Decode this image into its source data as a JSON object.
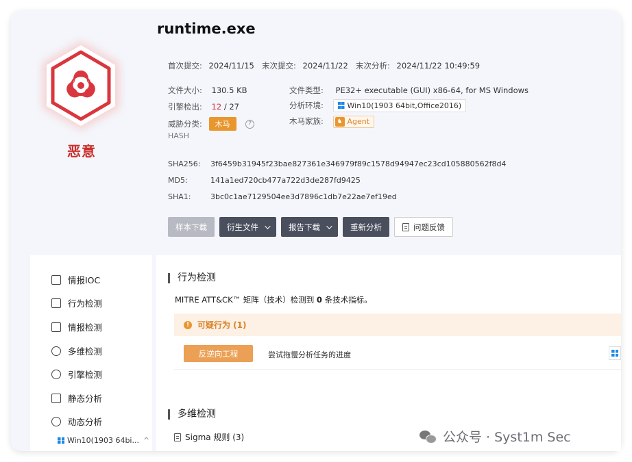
{
  "file": {
    "name": "runtime.exe",
    "verdict": "恶意",
    "first_submit_label": "首次提交:",
    "first_submit": "2024/11/15",
    "last_submit_label": "末次提交:",
    "last_submit": "2024/11/22",
    "last_analysis_label": "末次分析:",
    "last_analysis": "2024/11/22 10:49:59",
    "size_label": "文件大小:",
    "size": "130.5 KB",
    "type_label": "文件类型:",
    "type": "PE32+ executable (GUI) x86-64, for MS Windows",
    "engine_label": "引擎检出:",
    "engine_hits": "12",
    "engine_total": "/ 27",
    "env_label": "分析环境:",
    "env": "Win10(1903 64bit,Office2016)",
    "threat_label": "威胁分类:",
    "threat": "木马",
    "family_label": "木马家族:",
    "family": "Agent"
  },
  "hash": {
    "heading": "HASH",
    "sha256_label": "SHA256:",
    "sha256": "3f6459b31945f23bae827361e346979f89c1578d94947ec23cd105880562f8d4",
    "md5_label": "MD5:",
    "md5": "141a1ed720cb477a722d3de287fd9425",
    "sha1_label": "SHA1:",
    "sha1": "3bc0c1ae7129504ee3d7896c1db7e22ae7ef19ed"
  },
  "actions": {
    "download_sample": "样本下载",
    "derived_files": "衍生文件",
    "report_download": "报告下载",
    "reanalyze": "重新分析",
    "feedback": "问题反馈"
  },
  "sidebar": {
    "items": [
      {
        "label": "情报IOC",
        "icon": "checklist-icon"
      },
      {
        "label": "行为检测",
        "icon": "chart-icon"
      },
      {
        "label": "情报检测",
        "icon": "layout-icon"
      },
      {
        "label": "多维检测",
        "icon": "radar-icon"
      },
      {
        "label": "引擎检测",
        "icon": "engine-icon"
      },
      {
        "label": "静态分析",
        "icon": "list-icon"
      },
      {
        "label": "动态分析",
        "icon": "cycle-icon"
      }
    ],
    "sub_env": "Win10(1903 64bi...",
    "sub_chevron": "^"
  },
  "behavior": {
    "title": "行为检测",
    "mitre_prefix": "MITRE ATT&CK™ 矩阵（技术）检测到",
    "mitre_count": "0",
    "mitre_suffix": "条技术指标。",
    "suspicious_label": "可疑行为 (1)",
    "tag": "反逆向工程",
    "desc": "尝试拖慢分析任务的进度"
  },
  "multi": {
    "title": "多维检测",
    "sigma": "Sigma 规则 (3)"
  },
  "watermark": "公众号 · Syst1m Sec",
  "colors": {
    "malicious": "#c9302c",
    "warning": "#e9962f",
    "dark_button": "#4a4f5e"
  }
}
